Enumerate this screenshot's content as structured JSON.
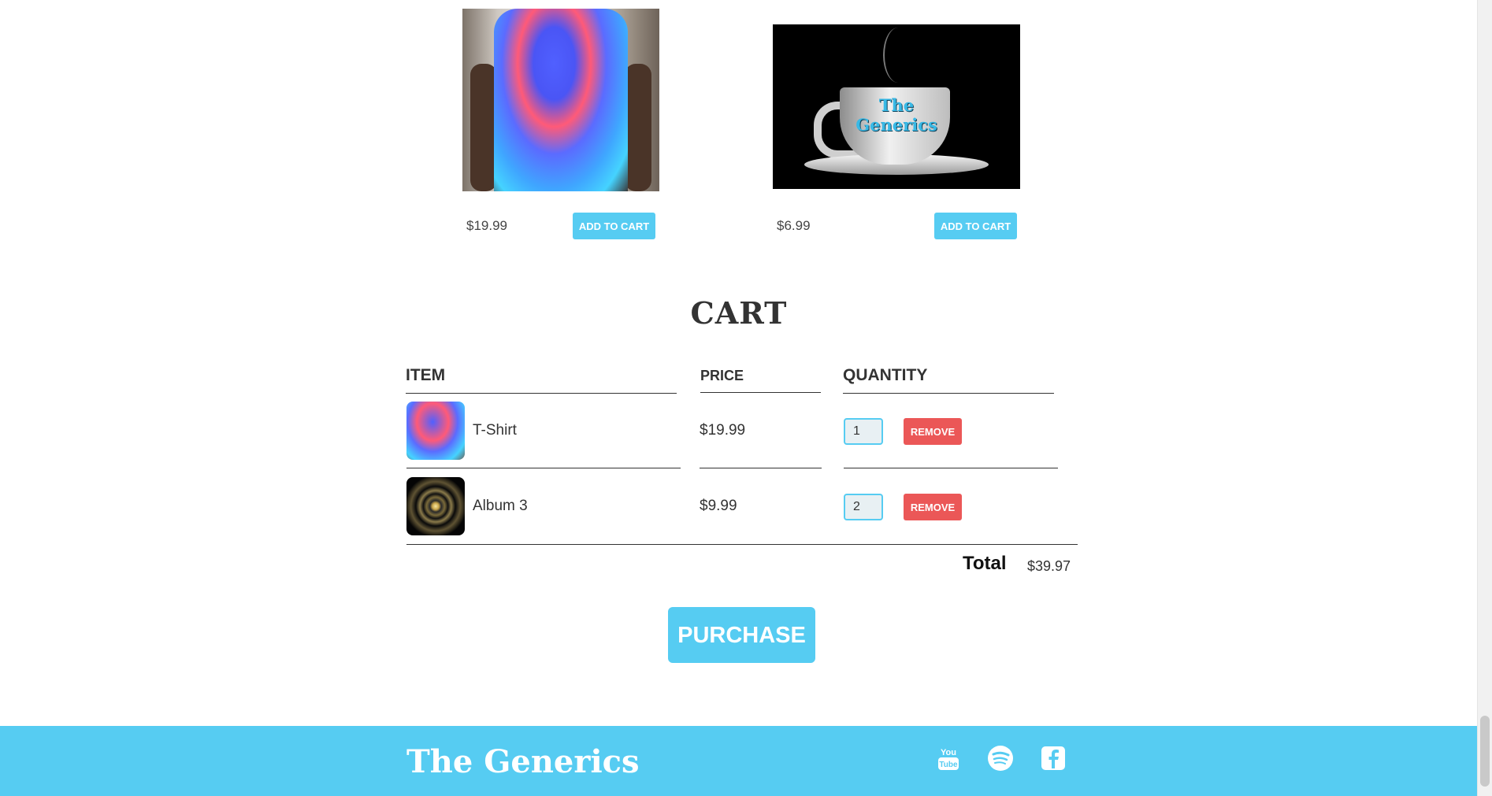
{
  "store": {
    "items": [
      {
        "name": "T-Shirt",
        "price": "$19.99",
        "button": "ADD TO CART"
      },
      {
        "name": "Coffee Cup",
        "price": "$6.99",
        "button": "ADD TO CART",
        "image_text": "The Generics"
      }
    ]
  },
  "cart": {
    "title": "CART",
    "headers": {
      "item": "ITEM",
      "price": "PRICE",
      "quantity": "QUANTITY"
    },
    "rows": [
      {
        "name": "T-Shirt",
        "price": "$19.99",
        "quantity": "1",
        "remove": "REMOVE"
      },
      {
        "name": "Album 3",
        "price": "$9.99",
        "quantity": "2",
        "remove": "REMOVE"
      }
    ],
    "total_label": "Total",
    "total_value": "$39.97",
    "purchase": "PURCHASE"
  },
  "footer": {
    "brand": "The Generics",
    "social": [
      "youtube-icon",
      "spotify-icon",
      "facebook-icon"
    ]
  },
  "colors": {
    "accent": "#56ccf2",
    "danger": "#eb5757",
    "text": "#333333"
  }
}
